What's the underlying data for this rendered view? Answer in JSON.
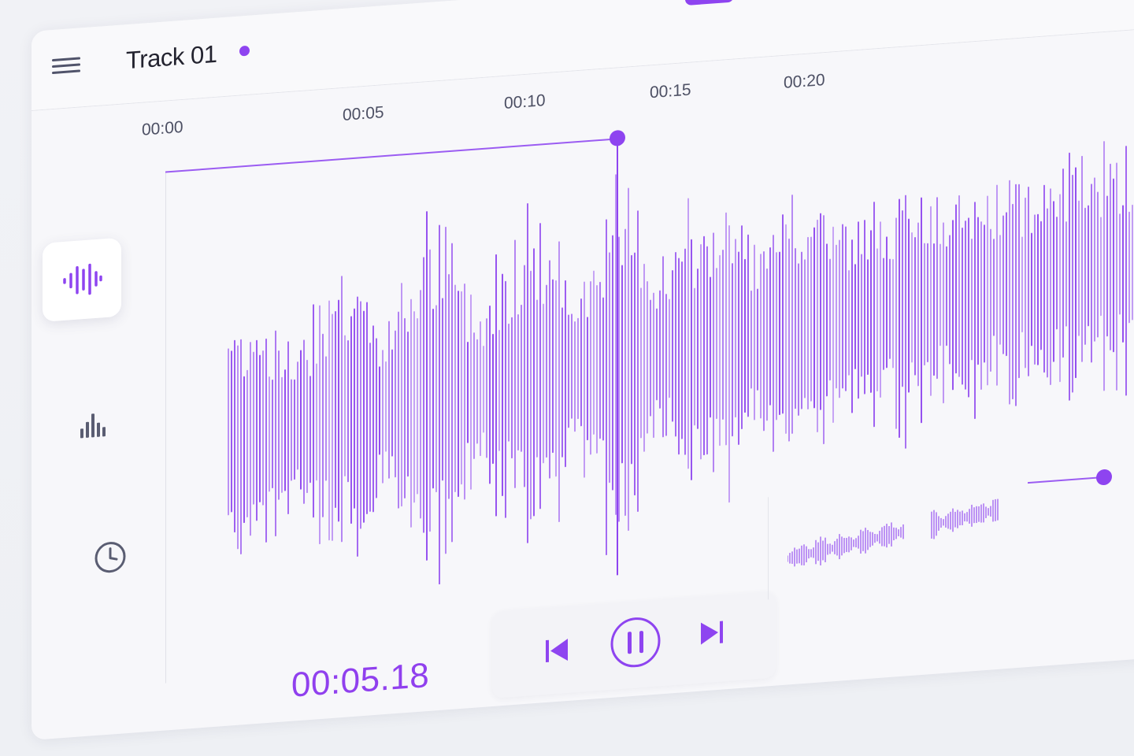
{
  "header": {
    "title": "Track 01",
    "menu_icon": "hamburger-menu-icon",
    "more_label": "···"
  },
  "sidebar": {
    "items": [
      {
        "name": "waveform",
        "icon": "waveform-icon",
        "active": true
      },
      {
        "name": "spectrum",
        "icon": "bar-chart-icon",
        "active": false
      },
      {
        "name": "history",
        "icon": "clock-icon",
        "active": false
      }
    ]
  },
  "timeline": {
    "ticks": [
      "00:00",
      "00:05",
      "00:10",
      "00:15",
      "00:20"
    ]
  },
  "playback": {
    "current_time": "00:05.18",
    "controls": [
      "previous-icon",
      "pause-icon",
      "next-icon"
    ]
  },
  "colors": {
    "accent": "#8e44f0",
    "text": "#23232f",
    "muted": "#4d5064"
  }
}
